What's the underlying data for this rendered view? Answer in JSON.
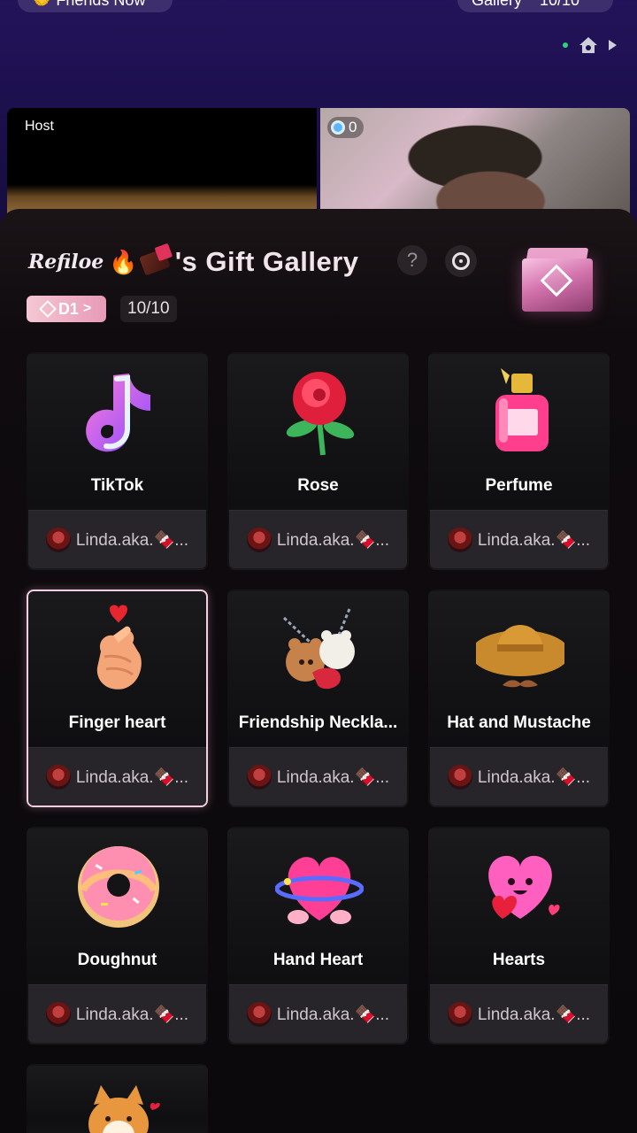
{
  "top": {
    "left_pill": "🤝 Friends Now",
    "right_pill_label": "Gallery",
    "right_pill_count": "10/10",
    "host_label": "Host",
    "guest_count": "0"
  },
  "panel": {
    "title_name": "Refiloe",
    "title_suffix": "'s Gift Gallery",
    "help_label": "?",
    "level": "D1",
    "level_chevron": ">",
    "progress": "10/10"
  },
  "gifts": [
    {
      "name": "TikTok",
      "giver": "Linda.aka.🍫..."
    },
    {
      "name": "Rose",
      "giver": "Linda.aka.🍫..."
    },
    {
      "name": "Perfume",
      "giver": "Linda.aka.🍫..."
    },
    {
      "name": "Finger heart",
      "giver": "Linda.aka.🍫..."
    },
    {
      "name": "Friendship Neckla...",
      "giver": "Linda.aka.🍫..."
    },
    {
      "name": "Hat and Mustache",
      "giver": "Linda.aka.🍫..."
    },
    {
      "name": "Doughnut",
      "giver": "Linda.aka.🍫..."
    },
    {
      "name": "Hand Heart",
      "giver": "Linda.aka.🍫..."
    },
    {
      "name": "Hearts",
      "giver": "Linda.aka.🍫..."
    }
  ],
  "colors": {
    "accent_pink": "#e79ab5",
    "selected_border": "#f4cfe0"
  }
}
